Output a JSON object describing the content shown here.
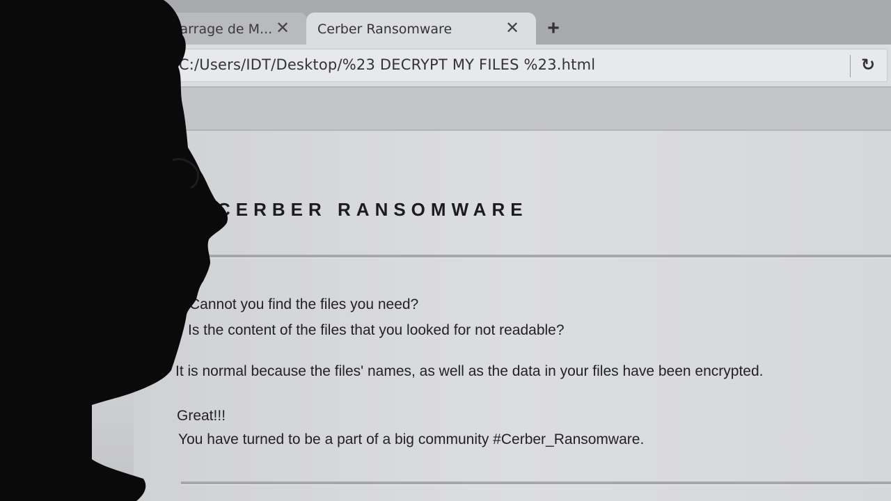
{
  "tabs": [
    {
      "title": "marrage de M...",
      "active": false
    },
    {
      "title": "Cerber Ransomware",
      "active": true
    }
  ],
  "toolbar": {
    "address": "file:///C:/Users/IDT/Desktop/%23 DECRYPT MY FILES %23.html"
  },
  "icons": {
    "tab_close": "close-icon",
    "new_tab": "plus-icon",
    "reload": "reload-icon"
  },
  "page": {
    "title": "CERBER RANSOMWARE",
    "paragraphs": [
      "Cannot you find the files you need?",
      "Is the content of the files that you looked for not readable?",
      "It is normal because the files' names, as well as the data in your files have been encrypted.",
      "Great!!!",
      "You have turned to be a part of a big community #Cerber_Ransomware."
    ]
  },
  "colors": {
    "screen_bg": "#d6d7da",
    "tab_active": "#dcdde0",
    "silhouette": "#0a0a0a"
  }
}
